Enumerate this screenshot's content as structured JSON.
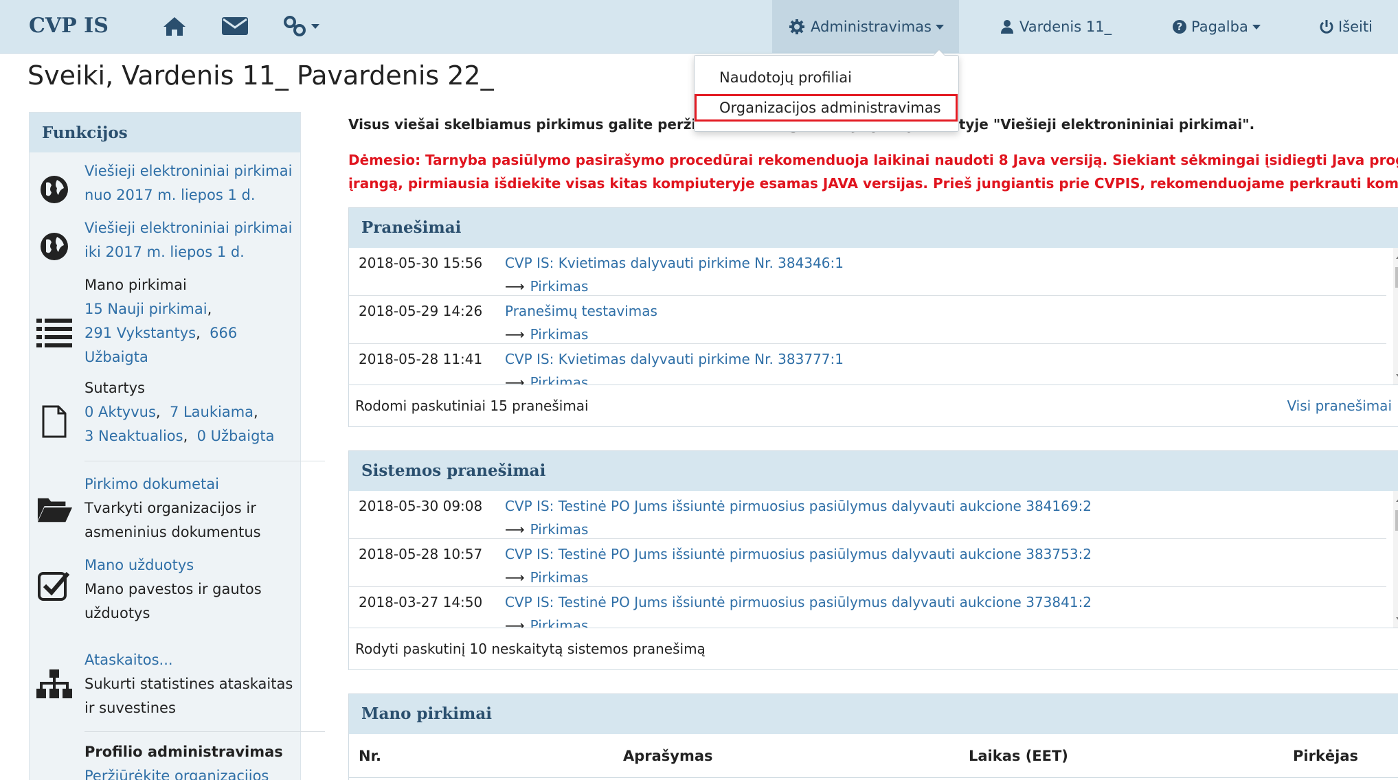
{
  "navbar": {
    "brand": "CVP IS",
    "home_icon": "home-icon",
    "mail_icon": "envelope-icon",
    "links_icon": "link-icon",
    "admin_label": "Administravimas",
    "user_label": "Vardenis 11_",
    "help_label": "Pagalba",
    "logout_label": "Išeiti"
  },
  "dropdown": {
    "items": [
      {
        "label": "Naudotojų profiliai"
      },
      {
        "label": "Organizacijos administravimas"
      }
    ]
  },
  "greeting": "Sveiki, Vardenis 11_ Pavardenis 22_",
  "sidebar": {
    "title": "Funkcijos",
    "public1": {
      "line1": "Viešieji elektroniniai pirkimai",
      "line2": "nuo 2017 m. liepos 1 d."
    },
    "public2": {
      "line1": "Viešieji elektroniniai pirkimai",
      "line2": "iki 2017 m. liepos 1 d."
    },
    "my_purchases": {
      "title": "Mano pirkimai",
      "new": "15 Nauji pirkimai",
      "active": "291 Vykstantys",
      "finished_count": "666",
      "finished_label": "Užbaigta"
    },
    "contracts": {
      "title": "Sutartys",
      "active": "0 Aktyvus",
      "waiting": "7 Laukiama",
      "inactive": "3 Neaktualios",
      "finished": "0 Užbaigta"
    },
    "docs": {
      "link": "Pirkimo dokumetai",
      "line1": "Tvarkyti organizacijos ir",
      "line2": "asmeninius dokumentus"
    },
    "tasks": {
      "link": "Mano užduotys",
      "line1": "Mano pavestos ir gautos",
      "line2": "užduotys"
    },
    "reports": {
      "link": "Ataskaitos...",
      "line1": "Sukurti statistines ataskaitas",
      "line2": "ir suvestines"
    },
    "profile": {
      "title": "Profilio administravimas",
      "link": "Peržiūrėkite organizacijos"
    }
  },
  "notice": {
    "black": "Visus viešai skelbiamus pirkimus galite peržiurėti šio lango kairėje pusėje, skiltyje \"Viešieji elektronininiai pirkimai\".",
    "red_line1": "Dėmesio: Tarnyba pasiūlymo pasirašymo procedūrai rekomenduoja laikinai naudoti 8 Java versiją. Siekiant sėkmingai įsidiegti Java programinę",
    "red_line2": "įrangą, pirmiausia išdiekite visas kitas kompiuteryje esamas JAVA versijas. Prieš jungiantis prie CVPIS, rekomenduojame perkrauti kompiuterį."
  },
  "messages": {
    "title": "Pranešimai",
    "rows": [
      {
        "date": "2018-05-30 15:56",
        "title": "CVP IS: Kvietimas dalyvauti pirkime Nr. 384346:1",
        "sub": "Pirkimas"
      },
      {
        "date": "2018-05-29 14:26",
        "title": "Pranešimų testavimas",
        "sub": "Pirkimas"
      },
      {
        "date": "2018-05-28 11:41",
        "title": "CVP IS: Kvietimas dalyvauti pirkime Nr. 383777:1",
        "sub": "Pirkimas"
      }
    ],
    "footer": "Rodomi paskutiniai 15 pranešimai",
    "all_link": "Visi pranešimai"
  },
  "system_messages": {
    "title": "Sistemos pranešimai",
    "rows": [
      {
        "date": "2018-05-30 09:08",
        "title": "CVP IS: Testinė PO Jums išsiuntė pirmuosius pasiūlymus dalyvauti aukcione 384169:2",
        "sub": "Pirkimas"
      },
      {
        "date": "2018-05-28 10:57",
        "title": "CVP IS: Testinė PO Jums išsiuntė pirmuosius pasiūlymus dalyvauti aukcione 383753:2",
        "sub": "Pirkimas"
      },
      {
        "date": "2018-03-27 14:50",
        "title": "CVP IS: Testinė PO Jums išsiuntė pirmuosius pasiūlymus dalyvauti aukcione 373841:2",
        "sub": "Pirkimas"
      }
    ],
    "footer": "Rodyti paskutinį 10 neskaitytą sistemos pranešimą"
  },
  "my_purchases_panel": {
    "title": "Mano pirkimai",
    "columns": [
      "Nr.",
      "Aprašymas",
      "Laikas (EET)",
      "Pirkėjas"
    ]
  },
  "colors": {
    "accent": "#2f6fa7",
    "header_bg": "#d6e6ef",
    "warning": "#e0141e",
    "highlight_border": "#e31b23"
  }
}
